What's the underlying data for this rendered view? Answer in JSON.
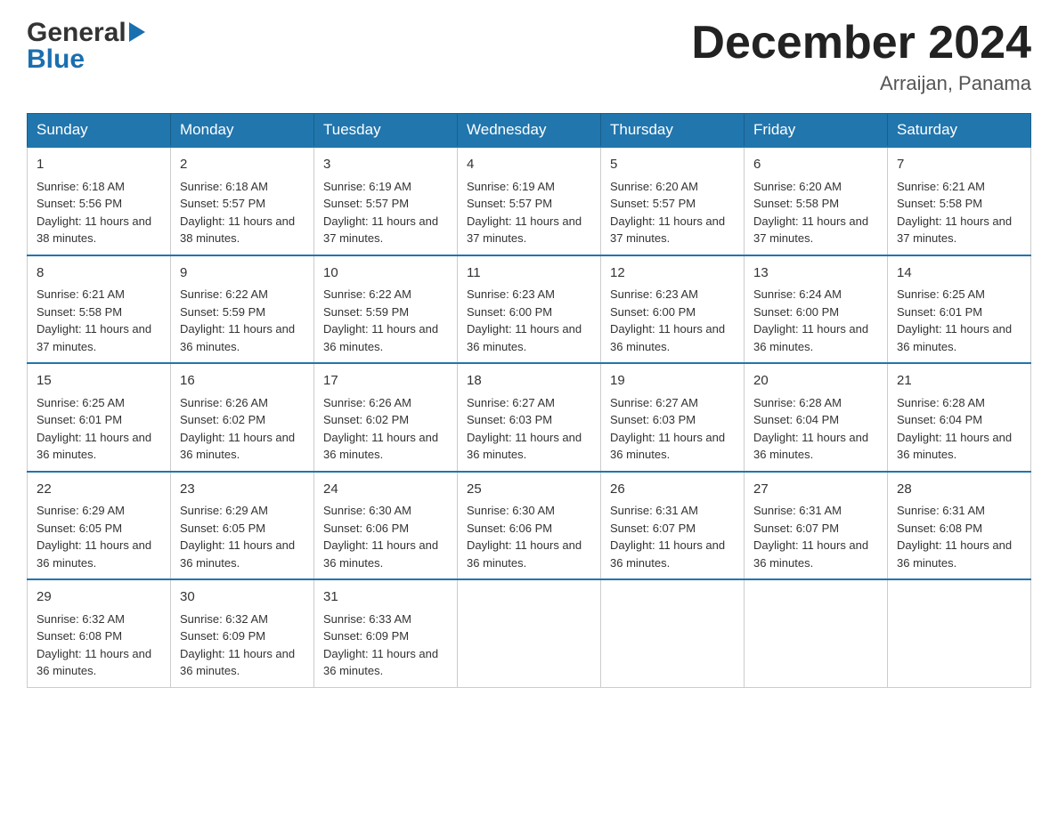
{
  "header": {
    "logo_general": "General",
    "logo_blue": "Blue",
    "title": "December 2024",
    "subtitle": "Arraijan, Panama"
  },
  "columns": [
    "Sunday",
    "Monday",
    "Tuesday",
    "Wednesday",
    "Thursday",
    "Friday",
    "Saturday"
  ],
  "weeks": [
    [
      {
        "day": "1",
        "sunrise": "6:18 AM",
        "sunset": "5:56 PM",
        "daylight": "11 hours and 38 minutes."
      },
      {
        "day": "2",
        "sunrise": "6:18 AM",
        "sunset": "5:57 PM",
        "daylight": "11 hours and 38 minutes."
      },
      {
        "day": "3",
        "sunrise": "6:19 AM",
        "sunset": "5:57 PM",
        "daylight": "11 hours and 37 minutes."
      },
      {
        "day": "4",
        "sunrise": "6:19 AM",
        "sunset": "5:57 PM",
        "daylight": "11 hours and 37 minutes."
      },
      {
        "day": "5",
        "sunrise": "6:20 AM",
        "sunset": "5:57 PM",
        "daylight": "11 hours and 37 minutes."
      },
      {
        "day": "6",
        "sunrise": "6:20 AM",
        "sunset": "5:58 PM",
        "daylight": "11 hours and 37 minutes."
      },
      {
        "day": "7",
        "sunrise": "6:21 AM",
        "sunset": "5:58 PM",
        "daylight": "11 hours and 37 minutes."
      }
    ],
    [
      {
        "day": "8",
        "sunrise": "6:21 AM",
        "sunset": "5:58 PM",
        "daylight": "11 hours and 37 minutes."
      },
      {
        "day": "9",
        "sunrise": "6:22 AM",
        "sunset": "5:59 PM",
        "daylight": "11 hours and 36 minutes."
      },
      {
        "day": "10",
        "sunrise": "6:22 AM",
        "sunset": "5:59 PM",
        "daylight": "11 hours and 36 minutes."
      },
      {
        "day": "11",
        "sunrise": "6:23 AM",
        "sunset": "6:00 PM",
        "daylight": "11 hours and 36 minutes."
      },
      {
        "day": "12",
        "sunrise": "6:23 AM",
        "sunset": "6:00 PM",
        "daylight": "11 hours and 36 minutes."
      },
      {
        "day": "13",
        "sunrise": "6:24 AM",
        "sunset": "6:00 PM",
        "daylight": "11 hours and 36 minutes."
      },
      {
        "day": "14",
        "sunrise": "6:25 AM",
        "sunset": "6:01 PM",
        "daylight": "11 hours and 36 minutes."
      }
    ],
    [
      {
        "day": "15",
        "sunrise": "6:25 AM",
        "sunset": "6:01 PM",
        "daylight": "11 hours and 36 minutes."
      },
      {
        "day": "16",
        "sunrise": "6:26 AM",
        "sunset": "6:02 PM",
        "daylight": "11 hours and 36 minutes."
      },
      {
        "day": "17",
        "sunrise": "6:26 AM",
        "sunset": "6:02 PM",
        "daylight": "11 hours and 36 minutes."
      },
      {
        "day": "18",
        "sunrise": "6:27 AM",
        "sunset": "6:03 PM",
        "daylight": "11 hours and 36 minutes."
      },
      {
        "day": "19",
        "sunrise": "6:27 AM",
        "sunset": "6:03 PM",
        "daylight": "11 hours and 36 minutes."
      },
      {
        "day": "20",
        "sunrise": "6:28 AM",
        "sunset": "6:04 PM",
        "daylight": "11 hours and 36 minutes."
      },
      {
        "day": "21",
        "sunrise": "6:28 AM",
        "sunset": "6:04 PM",
        "daylight": "11 hours and 36 minutes."
      }
    ],
    [
      {
        "day": "22",
        "sunrise": "6:29 AM",
        "sunset": "6:05 PM",
        "daylight": "11 hours and 36 minutes."
      },
      {
        "day": "23",
        "sunrise": "6:29 AM",
        "sunset": "6:05 PM",
        "daylight": "11 hours and 36 minutes."
      },
      {
        "day": "24",
        "sunrise": "6:30 AM",
        "sunset": "6:06 PM",
        "daylight": "11 hours and 36 minutes."
      },
      {
        "day": "25",
        "sunrise": "6:30 AM",
        "sunset": "6:06 PM",
        "daylight": "11 hours and 36 minutes."
      },
      {
        "day": "26",
        "sunrise": "6:31 AM",
        "sunset": "6:07 PM",
        "daylight": "11 hours and 36 minutes."
      },
      {
        "day": "27",
        "sunrise": "6:31 AM",
        "sunset": "6:07 PM",
        "daylight": "11 hours and 36 minutes."
      },
      {
        "day": "28",
        "sunrise": "6:31 AM",
        "sunset": "6:08 PM",
        "daylight": "11 hours and 36 minutes."
      }
    ],
    [
      {
        "day": "29",
        "sunrise": "6:32 AM",
        "sunset": "6:08 PM",
        "daylight": "11 hours and 36 minutes."
      },
      {
        "day": "30",
        "sunrise": "6:32 AM",
        "sunset": "6:09 PM",
        "daylight": "11 hours and 36 minutes."
      },
      {
        "day": "31",
        "sunrise": "6:33 AM",
        "sunset": "6:09 PM",
        "daylight": "11 hours and 36 minutes."
      },
      null,
      null,
      null,
      null
    ]
  ]
}
